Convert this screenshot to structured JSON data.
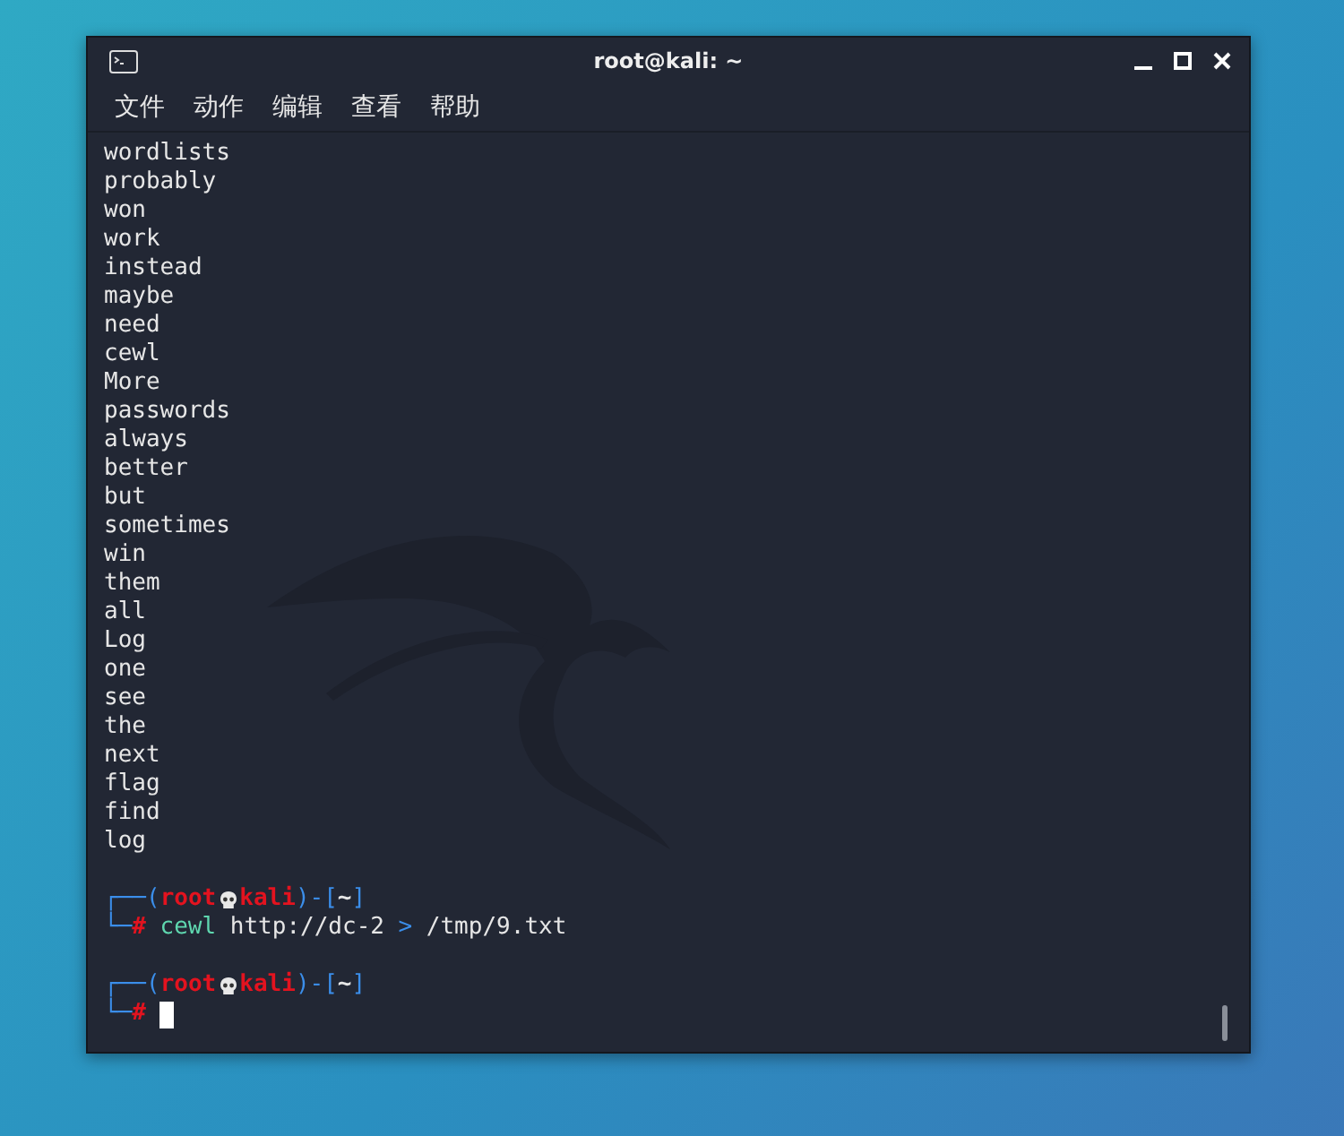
{
  "window": {
    "title": "root@kali: ~"
  },
  "menu": [
    "文件",
    "动作",
    "编辑",
    "查看",
    "帮助"
  ],
  "output": [
    "wordlists",
    "probably",
    "won",
    "work",
    "instead",
    "maybe",
    "need",
    "cewl",
    "More",
    "passwords",
    "always",
    "better",
    "but",
    "sometimes",
    "win",
    "them",
    "all",
    "Log",
    "one",
    "see",
    "the",
    "next",
    "flag",
    "find",
    "log"
  ],
  "prompts": [
    {
      "top": "┌──(",
      "user": "root",
      "host": "kali",
      "mid": ")-[",
      "dir": "~",
      "close": "]",
      "bottom": "└─",
      "sign": "#",
      "cursor": false,
      "tokens": [
        {
          "kind": "command",
          "text": "cewl"
        },
        {
          "kind": "arg",
          "text": "http://dc-2"
        },
        {
          "kind": "operator",
          "text": ">"
        },
        {
          "kind": "arg",
          "text": "/tmp/9.txt"
        }
      ]
    },
    {
      "top": "┌──(",
      "user": "root",
      "host": "kali",
      "mid": ")-[",
      "dir": "~",
      "close": "]",
      "bottom": "└─",
      "sign": "#",
      "cursor": true
    }
  ]
}
